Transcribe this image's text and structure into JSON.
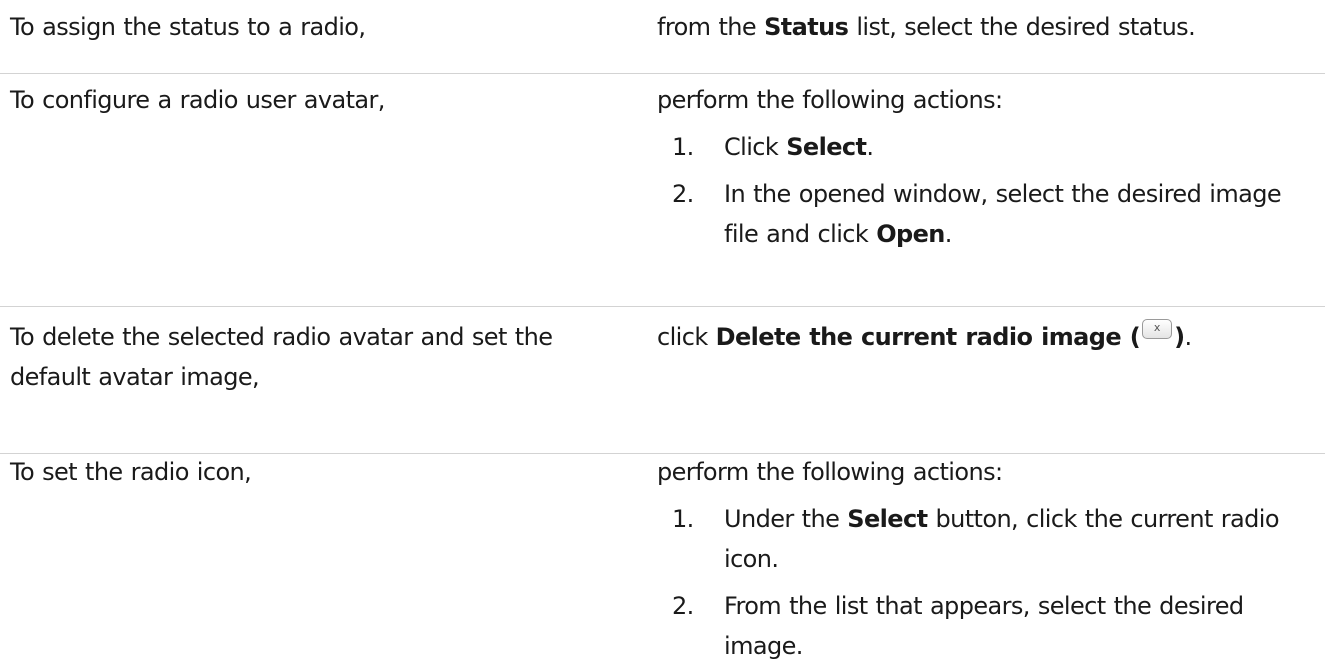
{
  "rows": [
    {
      "action": "To assign the status to a radio,",
      "pre": "from the ",
      "bold": "Status",
      "post": " list, select the desired status."
    },
    {
      "action": "To configure a radio user avatar,",
      "intro": "perform the following actions:",
      "steps": [
        {
          "num": "1.",
          "pre": "Click ",
          "bold": "Select",
          "post": "."
        },
        {
          "num": "2.",
          "text": "In the opened window, select the desired image",
          "text2_pre": "file and click ",
          "bold": "Open",
          "post": "."
        }
      ]
    },
    {
      "action_line1": "To delete the selected radio avatar and set the",
      "action_line2": "default avatar image,",
      "pre": "click ",
      "bold": "Delete the current radio image (",
      "icon_glyph": "x",
      "icon_name": "close-icon",
      "bold2": ")",
      "post": "."
    },
    {
      "action": "To set the radio icon,",
      "intro": "perform the following actions:",
      "steps": [
        {
          "num": "1.",
          "pre": "Under the ",
          "bold": "Select",
          "post": " button, click the current radio",
          "line2": "icon."
        },
        {
          "num": "2.",
          "line1": "From the list that appears, select the desired",
          "line2": "image."
        }
      ]
    }
  ]
}
